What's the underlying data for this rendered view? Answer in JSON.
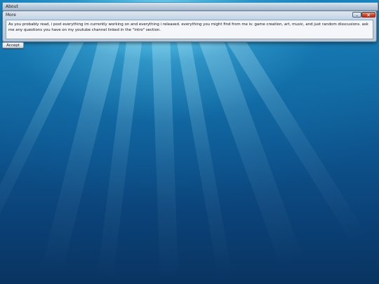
{
  "about_window": {
    "title": "About"
  },
  "more_window": {
    "title": "More",
    "minimize_glyph": "–",
    "close_glyph": "✕",
    "text": "As you probably read, i post everything im currently working on and everything i released. everything you might find from me is: game creation, art, music, and just random disscusions. ask me any questions you have on my youtube channel linked in the \"intro\" section."
  },
  "accept_button": {
    "label": "Accept"
  },
  "icons": {
    "minimize": "minimize-icon",
    "close": "close-icon"
  },
  "colors": {
    "close_button": "#c94a34",
    "desktop_deep": "#093461",
    "desktop_light": "#7fdcf7"
  }
}
